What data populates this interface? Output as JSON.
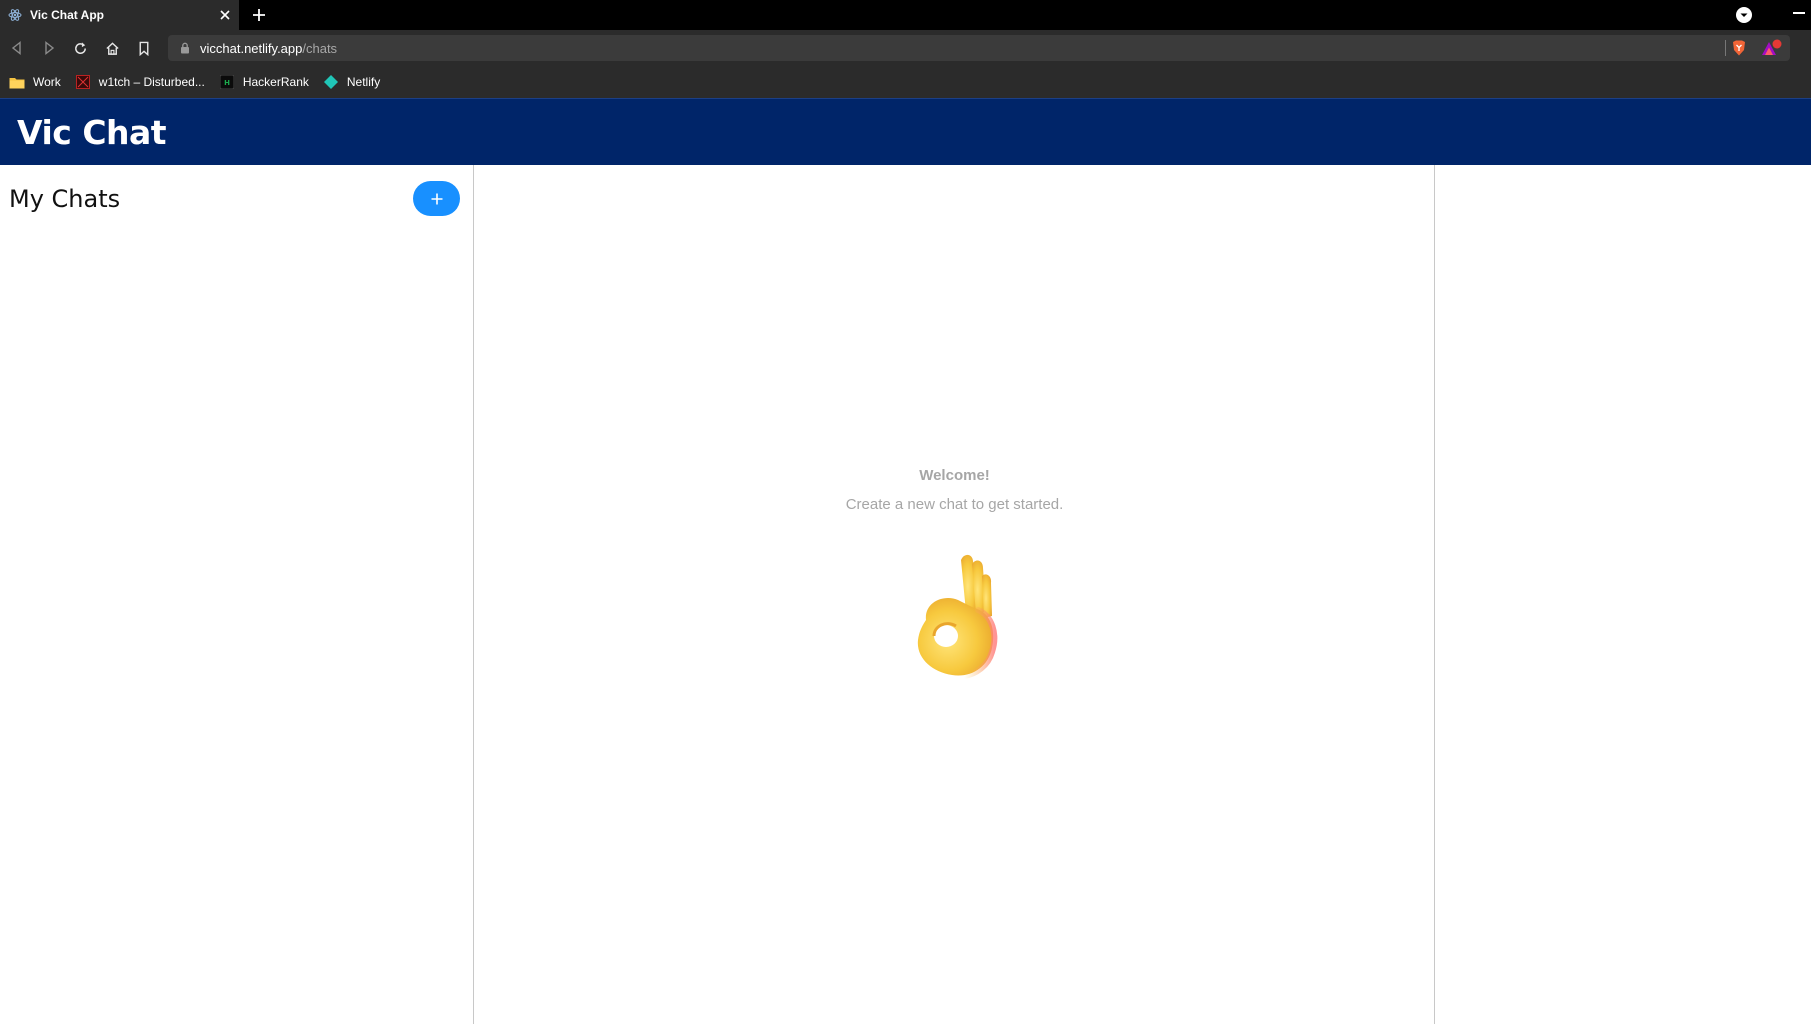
{
  "browser": {
    "tab": {
      "title": "Vic Chat App",
      "favicon": "react-icon"
    },
    "url": {
      "host": "vicchat.netlify.app",
      "path": "/chats"
    },
    "bookmarks": [
      {
        "label": "Work",
        "icon": "folder-icon"
      },
      {
        "label": "w1tch – Disturbed...",
        "icon": "w1tch-icon"
      },
      {
        "label": "HackerRank",
        "icon": "hackerrank-icon"
      },
      {
        "label": "Netlify",
        "icon": "netlify-icon"
      }
    ]
  },
  "app": {
    "title": "Vic Chat",
    "brand_color": "#002569",
    "accent_color": "#1890ff"
  },
  "sidebar": {
    "title": "My Chats",
    "add_button_icon": "plus-icon"
  },
  "main": {
    "welcome_title": "Welcome!",
    "welcome_subtitle": "Create a new chat to get started.",
    "illustration": "ok-hand-icon"
  }
}
